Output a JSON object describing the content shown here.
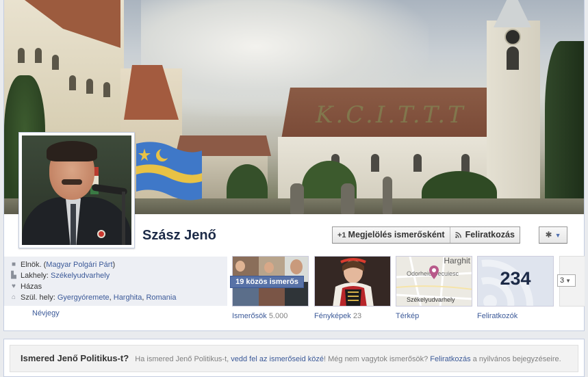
{
  "profile": {
    "name": "Szász Jenő"
  },
  "cover": {
    "watermark": "K.C.I.T.T.T"
  },
  "actions": {
    "add_friend_label": "Megjelölés ismerősként",
    "add_friend_icon": "+1",
    "subscribe_label": "Feliratkozás",
    "subscribe_icon": "rss-icon",
    "settings_icon": "gear-icon"
  },
  "info": {
    "work_prefix": "Elnök. (",
    "work_org": "Magyar Polgári Párt",
    "work_suffix": ")",
    "lives_prefix": "Lakhely: ",
    "lives_city": "Székelyudvarhely",
    "relationship": "Házas",
    "born_prefix": "Szül. hely: ",
    "born_place1": "Gyergyóremete",
    "born_sep1": ", ",
    "born_place2": "Harghita",
    "born_sep2": ", ",
    "born_place3": "Romania",
    "about_link": "Névjegy"
  },
  "tiles": {
    "friends_label": "Ismerősök",
    "friends_count": "5.000",
    "mutual_friends": "19 közös ismerős",
    "photos_label": "Fényképek",
    "photos_count": "23",
    "map_label": "Térkép",
    "map_text1": "Harghit",
    "map_text2": "Odorheiu Secuiesc",
    "map_text3": "Székelyudvarhely",
    "subs_label": "Feliratkozók",
    "subs_count": "234",
    "more_count": "3"
  },
  "know": {
    "title": "Ismered Jenő Politikus-t?",
    "text1": "Ha ismered Jenő Politikus-t, ",
    "link1": "vedd fel az ismerőseid közé",
    "text2": "! Még nem vagytok ismerősök? ",
    "link2": "Feliratkozás",
    "text3": " a nyilvános bejegyzéseire."
  },
  "colors": {
    "link": "#3b5998",
    "name": "#1c2a47",
    "badge": "#5872a7"
  }
}
